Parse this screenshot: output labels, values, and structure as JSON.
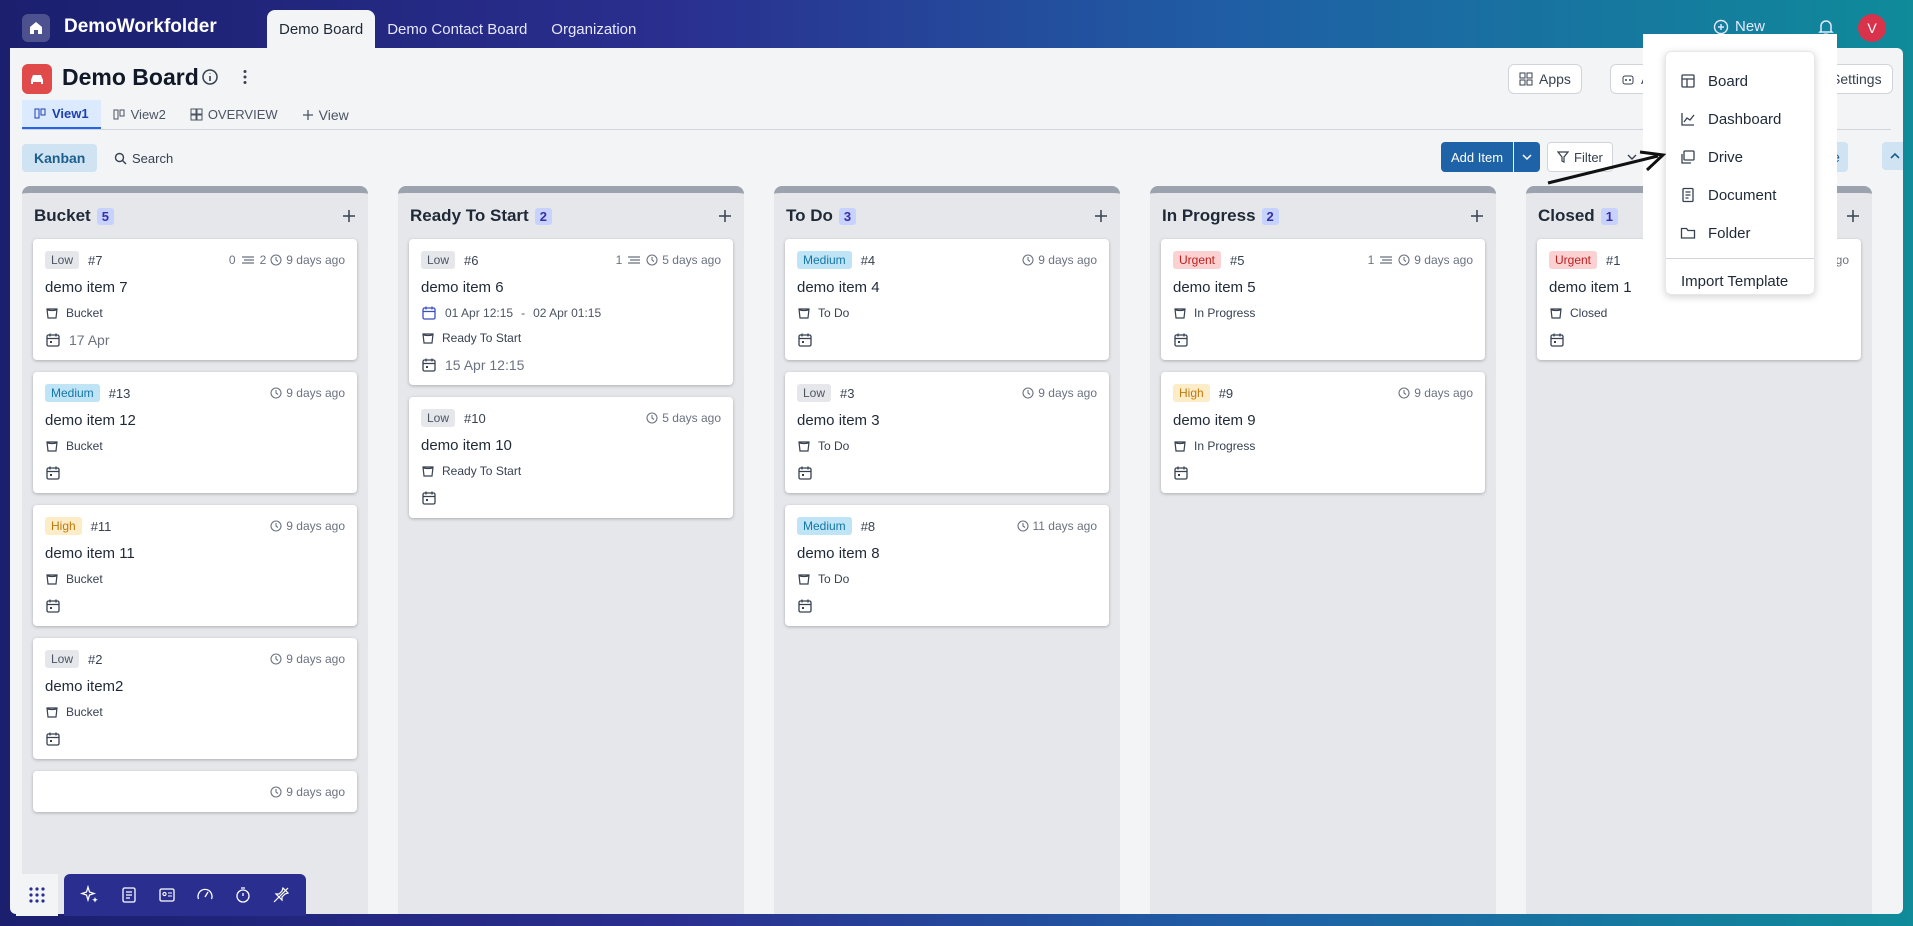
{
  "workspace": {
    "name": "DemoWorkfolder"
  },
  "top_tabs": [
    {
      "label": "Demo Board"
    },
    {
      "label": "Demo Contact Board"
    },
    {
      "label": "Organization"
    }
  ],
  "top_right": {
    "new_label": "New",
    "avatar_initial": "V"
  },
  "board": {
    "title": "Demo Board"
  },
  "header_buttons": {
    "apps": "Apps",
    "automations": "Au",
    "settings": "Settings"
  },
  "views": [
    {
      "label": "View1"
    },
    {
      "label": "View2"
    },
    {
      "label": "OVERVIEW"
    },
    {
      "label": "View"
    }
  ],
  "toolbar": {
    "kanban": "Kanban",
    "search": "Search",
    "add_item": "Add Item",
    "filter": "Filter",
    "more": "More"
  },
  "columns": [
    {
      "title": "Bucket",
      "count": "5",
      "cards": [
        {
          "priority": "Low",
          "id": "#7",
          "sub_done": "0",
          "sub_total": "2",
          "time": "9 days ago",
          "title": "demo item 7",
          "status": "Bucket",
          "date": "17 Apr"
        },
        {
          "priority": "Medium",
          "id": "#13",
          "time": "9 days ago",
          "title": "demo item 12",
          "status": "Bucket",
          "date": ""
        },
        {
          "priority": "High",
          "id": "#11",
          "time": "9 days ago",
          "title": "demo item 11",
          "status": "Bucket",
          "date": ""
        },
        {
          "priority": "Low",
          "id": "#2",
          "time": "9 days ago",
          "title": "demo item2",
          "status": "Bucket",
          "date": ""
        },
        {
          "time": "9 days ago"
        }
      ]
    },
    {
      "title": "Ready To Start",
      "count": "2",
      "cards": [
        {
          "priority": "Low",
          "id": "#6",
          "sub_done": "1",
          "time": "5 days ago",
          "title": "demo item 6",
          "range_start": "01 Apr 12:15",
          "range_end": "02 Apr 01:15",
          "status": "Ready To Start",
          "date": "15 Apr 12:15"
        },
        {
          "priority": "Low",
          "id": "#10",
          "time": "5 days ago",
          "title": "demo item 10",
          "status": "Ready To Start",
          "date": ""
        }
      ]
    },
    {
      "title": "To Do",
      "count": "3",
      "cards": [
        {
          "priority": "Medium",
          "id": "#4",
          "time": "9 days ago",
          "title": "demo item 4",
          "status": "To Do",
          "date": ""
        },
        {
          "priority": "Low",
          "id": "#3",
          "time": "9 days ago",
          "title": "demo item 3",
          "status": "To Do",
          "date": ""
        },
        {
          "priority": "Medium",
          "id": "#8",
          "time": "11 days ago",
          "title": "demo item 8",
          "status": "To Do",
          "date": ""
        }
      ]
    },
    {
      "title": "In Progress",
      "count": "2",
      "cards": [
        {
          "priority": "Urgent",
          "id": "#5",
          "sub_done": "1",
          "time": "9 days ago",
          "title": "demo item 5",
          "status": "In Progress",
          "date": ""
        },
        {
          "priority": "High",
          "id": "#9",
          "time": "9 days ago",
          "title": "demo item 9",
          "status": "In Progress",
          "date": ""
        }
      ]
    },
    {
      "title": "Closed",
      "count": "1",
      "cards": [
        {
          "priority": "Urgent",
          "id": "#1",
          "time": "days ago",
          "title": "demo item 1",
          "status": "Closed",
          "date": ""
        }
      ]
    }
  ],
  "new_menu": {
    "items": [
      {
        "label": "Board",
        "icon": "board-icon"
      },
      {
        "label": "Dashboard",
        "icon": "chart-icon"
      },
      {
        "label": "Drive",
        "icon": "drive-icon"
      },
      {
        "label": "Document",
        "icon": "document-icon"
      },
      {
        "label": "Folder",
        "icon": "folder-icon"
      }
    ],
    "import_label": "Import Template"
  },
  "colors": {
    "accent": "#1e63a8",
    "low": "#e5e7eb",
    "medium": "#bfe4f6",
    "high": "#fdecc8",
    "urgent": "#fbd1d1"
  }
}
